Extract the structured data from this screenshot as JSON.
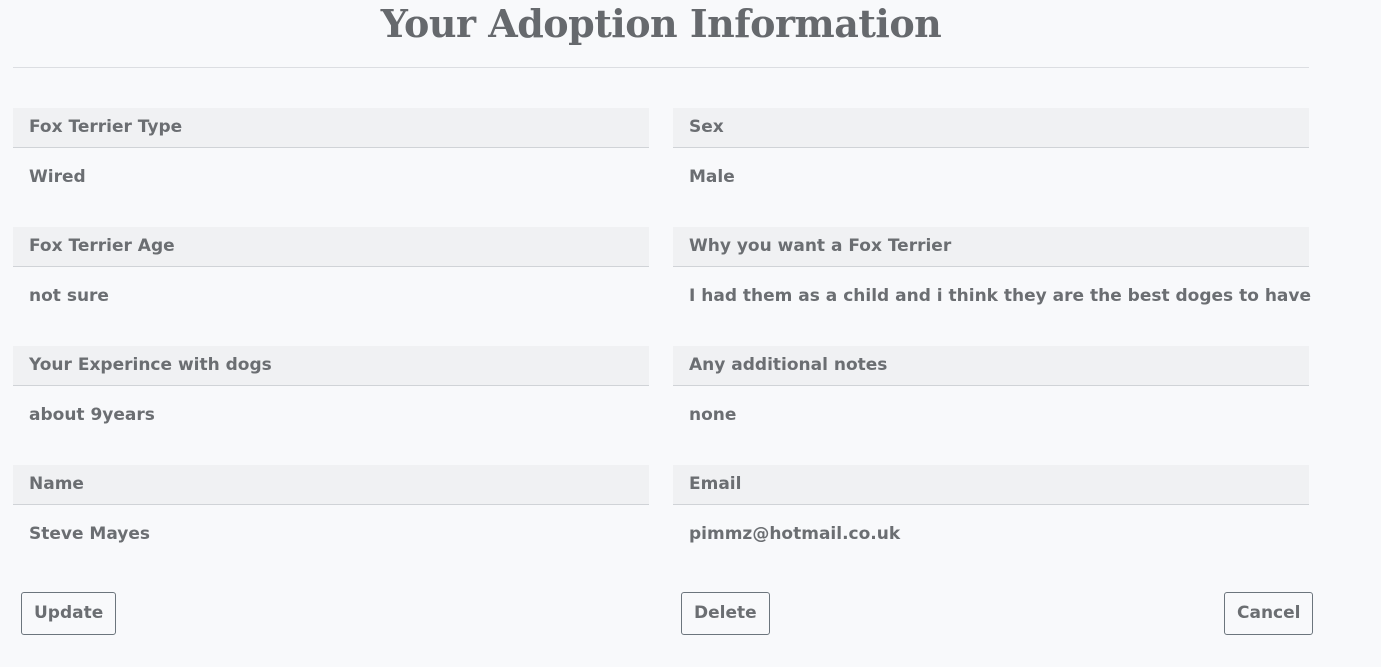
{
  "page": {
    "title": "Your Adoption Information"
  },
  "fields": {
    "type": {
      "label": "Fox Terrier Type",
      "value": "Wired"
    },
    "sex": {
      "label": "Sex",
      "value": "Male"
    },
    "age": {
      "label": "Fox Terrier Age",
      "value": "not sure"
    },
    "why": {
      "label": "Why you want a Fox Terrier",
      "value": "I had them as a child and i think they are the best doges to have"
    },
    "experience": {
      "label": "Your Experince with dogs",
      "value": "about 9years"
    },
    "notes": {
      "label": "Any additional notes",
      "value": "none"
    },
    "name": {
      "label": "Name",
      "value": "Steve Mayes"
    },
    "email": {
      "label": "Email",
      "value": "pimmz@hotmail.co.uk"
    }
  },
  "actions": {
    "update_label": "Update",
    "delete_label": "Delete",
    "cancel_label": "Cancel"
  }
}
